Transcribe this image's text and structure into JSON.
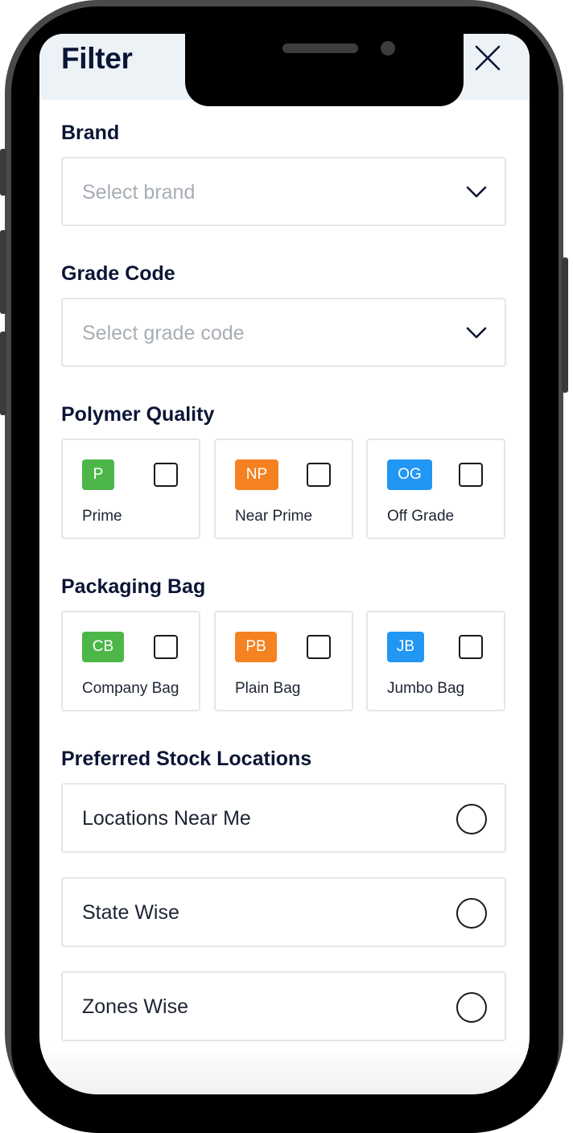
{
  "header": {
    "title": "Filter",
    "close_icon": "close-icon"
  },
  "brand": {
    "label": "Brand",
    "placeholder": "Select brand",
    "icon": "chevron-down-icon"
  },
  "grade_code": {
    "label": "Grade Code",
    "placeholder": "Select grade code",
    "icon": "chevron-down-icon"
  },
  "polymer_quality": {
    "label": "Polymer Quality",
    "options": [
      {
        "badge": "P",
        "label": "Prime",
        "color": "#4cb748",
        "checked": false
      },
      {
        "badge": "NP",
        "label": "Near Prime",
        "color": "#f58220",
        "checked": false
      },
      {
        "badge": "OG",
        "label": "Off Grade",
        "color": "#2196f3",
        "checked": false
      }
    ]
  },
  "packaging_bag": {
    "label": "Packaging Bag",
    "options": [
      {
        "badge": "CB",
        "label": "Company Bag",
        "color": "#4cb748",
        "checked": false
      },
      {
        "badge": "PB",
        "label": "Plain Bag",
        "color": "#f58220",
        "checked": false
      },
      {
        "badge": "JB",
        "label": "Jumbo Bag",
        "color": "#2196f3",
        "checked": false
      }
    ]
  },
  "stock_locations": {
    "label": "Preferred Stock Locations",
    "options": [
      {
        "label": "Locations Near Me",
        "selected": false
      },
      {
        "label": "State Wise",
        "selected": false
      },
      {
        "label": "Zones Wise",
        "selected": false
      }
    ]
  }
}
